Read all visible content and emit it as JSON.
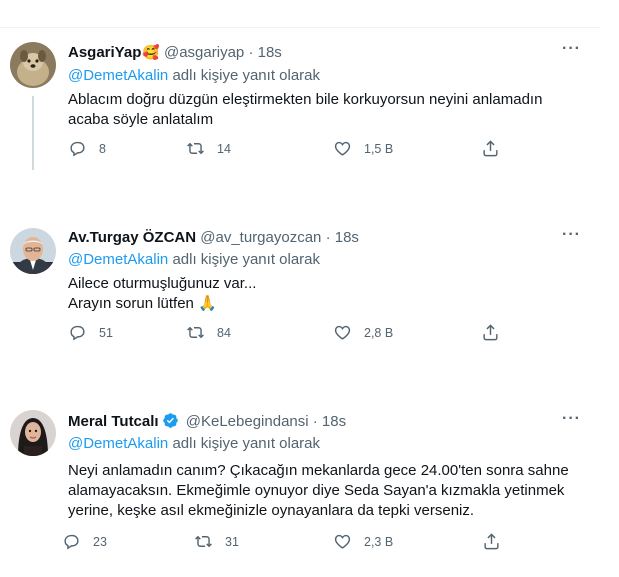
{
  "tweets": [
    {
      "name": "AsgariYap",
      "name_emoji": "🥰",
      "handle": "@asgariyap",
      "time": "· 18s",
      "more": "···",
      "replying_to": "@DemetAkalin",
      "replying_suffix": "adlı kişiye yanıt olarak",
      "text_lines": [
        "Ablacım doğru düzgün eleştirmekten bile korkuyorsun neyini anlamadın",
        "acaba söyle anlatalım"
      ],
      "replies": "8",
      "retweets": "14",
      "likes": "1,5 B"
    },
    {
      "name": "Av.Turgay ÖZCAN",
      "handle": "@av_turgayozcan",
      "time": "· 18s",
      "more": "···",
      "replying_to": "@DemetAkalin",
      "replying_suffix": "adlı kişiye yanıt olarak",
      "text_lines": [
        "Ailece oturmuşluğunuz var...",
        "Arayın sorun lütfen 🙏"
      ],
      "replies": "51",
      "retweets": "84",
      "likes": "2,8 B"
    },
    {
      "name": "Meral Tutcalı",
      "verified": true,
      "handle": "@KeLebegindansi",
      "time": "· 18s",
      "more": "···",
      "replying_to": "@DemetAkalin",
      "replying_suffix": "adlı kişiye yanıt olarak",
      "text_lines": [
        "Neyi anlamadın canım? Çıkacağın mekanlarda gece 24.00'ten sonra sahne",
        "alamayacaksın. Ekmeğimle oynuyor diye Seda Sayan'a kızmakla yetinmek",
        "yerine, keşke asıl ekmeğinizle oynayanlara da tepki verseniz."
      ],
      "replies": "23",
      "retweets": "31",
      "likes": "2,3 B"
    }
  ],
  "icons": {
    "reply": "reply-icon",
    "retweet": "retweet-icon",
    "like": "heart-icon",
    "share": "share-icon",
    "more": "more-icon",
    "verified": "verified-badge-icon"
  },
  "colors": {
    "accent": "#1d9bf0",
    "secondary_text": "#536471",
    "primary_text": "#0f1419"
  }
}
